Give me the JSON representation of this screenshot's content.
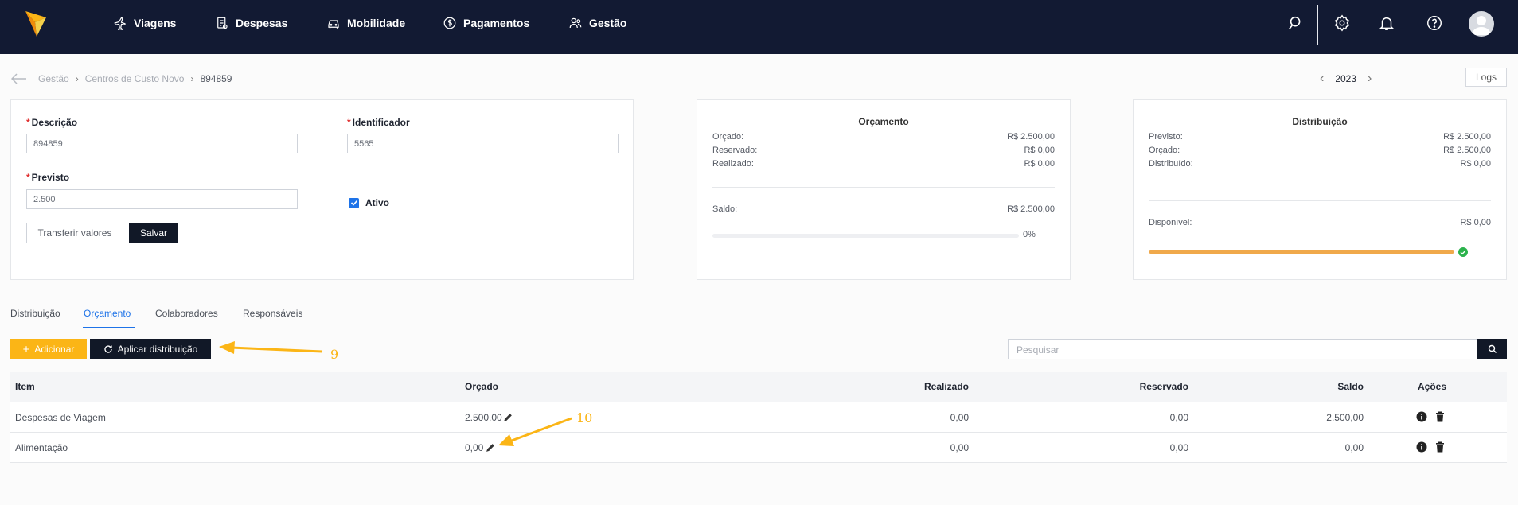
{
  "nav": {
    "items": [
      {
        "label": "Viagens",
        "icon": "plane-icon"
      },
      {
        "label": "Despesas",
        "icon": "receipt-icon"
      },
      {
        "label": "Mobilidade",
        "icon": "car-icon"
      },
      {
        "label": "Pagamentos",
        "icon": "dollar-icon"
      },
      {
        "label": "Gestão",
        "icon": "users-icon"
      }
    ],
    "right_icons": [
      "search-icon",
      "gear-icon",
      "bell-icon",
      "help-icon",
      "avatar"
    ]
  },
  "breadcrumb": {
    "items": [
      "Gestão",
      "Centros de Custo Novo"
    ],
    "current": "894859"
  },
  "year_nav": {
    "year": "2023"
  },
  "logs_label": "Logs",
  "form": {
    "descricao_label": "Descrição",
    "descricao_value": "894859",
    "identificador_label": "Identificador",
    "identificador_value": "5565",
    "previsto_label": "Previsto",
    "previsto_value": "2.500",
    "ativo_label": "Ativo",
    "ativo_checked": true,
    "transferir_label": "Transferir valores",
    "salvar_label": "Salvar"
  },
  "orcamento_card": {
    "title": "Orçamento",
    "rows": [
      {
        "label": "Orçado:",
        "value": "R$ 2.500,00"
      },
      {
        "label": "Reservado:",
        "value": "R$ 0,00"
      },
      {
        "label": "Realizado:",
        "value": "R$ 0,00"
      }
    ],
    "saldo_label": "Saldo:",
    "saldo_value": "R$ 2.500,00",
    "progress_label": "0%",
    "progress_fraction": 0.0
  },
  "distribuicao_card": {
    "title": "Distribuição",
    "rows": [
      {
        "label": "Previsto:",
        "value": "R$ 2.500,00"
      },
      {
        "label": "Orçado:",
        "value": "R$ 2.500,00"
      },
      {
        "label": "Distribuído:",
        "value": "R$ 0,00"
      }
    ],
    "disponivel_label": "Disponível:",
    "disponivel_value": "R$ 0,00",
    "progress_fraction": 1.0
  },
  "tabs": [
    {
      "label": "Distribuição",
      "active": false
    },
    {
      "label": "Orçamento",
      "active": true
    },
    {
      "label": "Colaboradores",
      "active": false
    },
    {
      "label": "Responsáveis",
      "active": false
    }
  ],
  "toolbar": {
    "adicionar_label": "Adicionar",
    "aplicar_label": "Aplicar distribuição",
    "search_placeholder": "Pesquisar"
  },
  "table": {
    "headers": [
      "Item",
      "Orçado",
      "Realizado",
      "Reservado",
      "Saldo",
      "Ações"
    ],
    "rows": [
      {
        "item": "Despesas de Viagem",
        "orcado": "2.500,00",
        "realizado": "0,00",
        "reservado": "0,00",
        "saldo": "2.500,00"
      },
      {
        "item": "Alimentação",
        "orcado": "0,00",
        "realizado": "0,00",
        "reservado": "0,00",
        "saldo": "0,00"
      }
    ]
  },
  "annotations": {
    "label_9": "9",
    "label_10": "10"
  },
  "colors": {
    "topbar": "#121a33",
    "accent_blue": "#1e73e8",
    "accent_yellow": "#fbb516",
    "progress_orange": "#f0a94b",
    "success_green": "#2bb24c"
  }
}
